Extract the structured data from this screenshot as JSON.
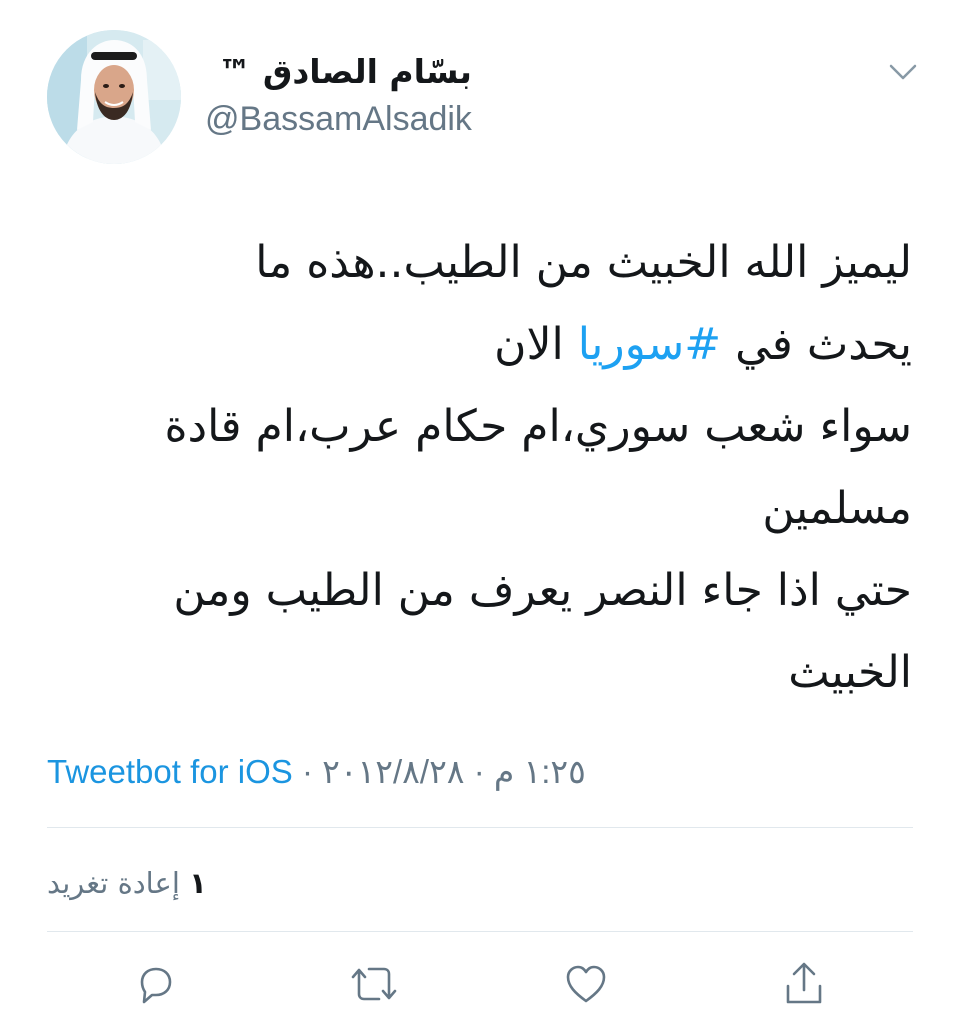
{
  "author": {
    "display_name": "بسّام الصادق ™",
    "handle": "@BassamAlsadik"
  },
  "tweet": {
    "lines": [
      [
        "ليميز الله الخبيث من الطيب..هذه ما"
      ],
      [
        "يحدث في ",
        "#سوريا",
        " الان"
      ],
      [
        "سواء شعب سوري،ام حكام عرب،ام قادة"
      ],
      [
        "مسلمين"
      ],
      [
        "حتي اذا جاء النصر يعرف من الطيب ومن"
      ],
      [
        "الخبيث"
      ]
    ],
    "hashtag": "#سوريا"
  },
  "meta": {
    "source": "Tweetbot for iOS",
    "separator": " · ",
    "date": "٢٠١٢/٨/٢٨",
    "time": "١:٢٥ م"
  },
  "stats": {
    "retweet_count": "١",
    "retweet_label": "إعادة تغريد"
  },
  "icons": {
    "reply": "reply-icon",
    "retweet": "retweet-icon",
    "like": "like-icon",
    "share": "share-icon",
    "caret": "chevron-down-icon"
  },
  "colors": {
    "link": "#1da1f2",
    "source": "#1b95e0",
    "muted": "#657786",
    "text": "#14171a",
    "divider": "#e1e8ed"
  }
}
